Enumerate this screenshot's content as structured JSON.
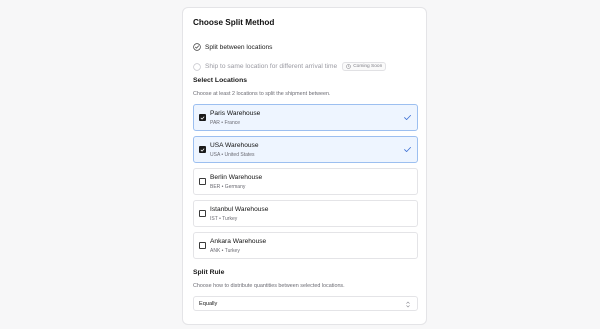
{
  "split_method": {
    "title": "Choose Split Method",
    "options": [
      {
        "label": "Split between locations",
        "selected": true,
        "disabled": false
      },
      {
        "label": "Ship to same location for different arrival time",
        "selected": false,
        "disabled": true,
        "badge": "Coming Soon"
      }
    ]
  },
  "locations": {
    "title": "Select Locations",
    "description": "Choose at least 2 locations to split the shipment between.",
    "items": [
      {
        "name": "Paris Warehouse",
        "sub": "PAR • France",
        "selected": true
      },
      {
        "name": "USA Warehouse",
        "sub": "USA • United States",
        "selected": true
      },
      {
        "name": "Berlin Warehouse",
        "sub": "BER • Germany",
        "selected": false
      },
      {
        "name": "Istanbul Warehouse",
        "sub": "IST • Turkey",
        "selected": false
      },
      {
        "name": "Ankara Warehouse",
        "sub": "ANK • Turkey",
        "selected": false
      }
    ]
  },
  "split_rule": {
    "title": "Split Rule",
    "description": "Choose how to distribute quantities between selected locations.",
    "selected": "Equally"
  },
  "colors": {
    "selected_bg": "#eef5ff",
    "selected_border": "#9cbff0",
    "accent_check": "#3b6fd4"
  }
}
